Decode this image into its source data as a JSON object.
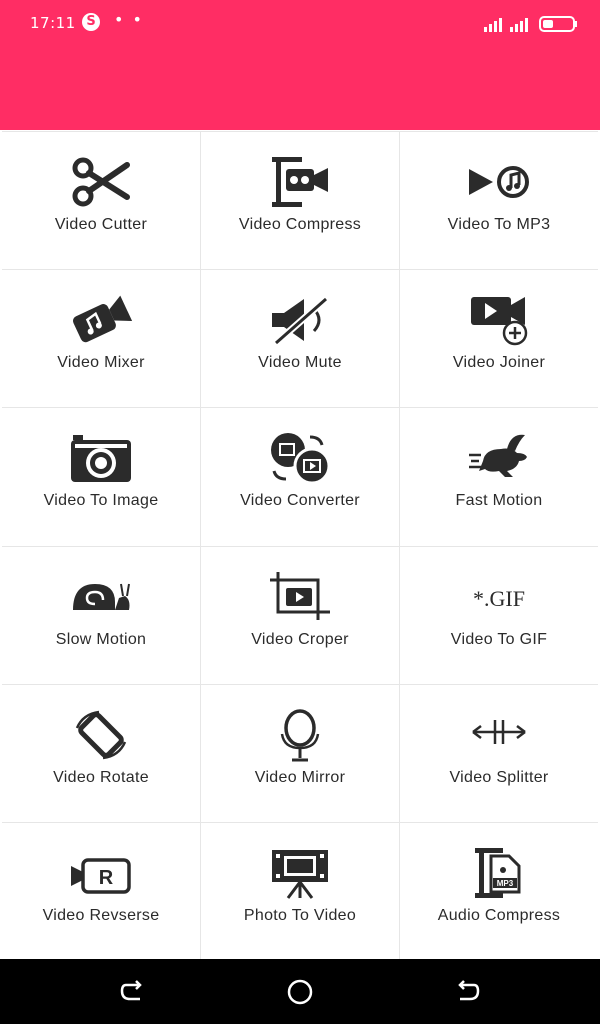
{
  "status": {
    "time": "17:11",
    "s_badge": "S",
    "dots": "• •"
  },
  "tools": [
    {
      "label": "Video Cutter",
      "icon": "scissors-icon"
    },
    {
      "label": "Video Compress",
      "icon": "compress-video-icon"
    },
    {
      "label": "Video To MP3",
      "icon": "video-to-mp3-icon"
    },
    {
      "label": "Video Mixer",
      "icon": "camera-music-icon"
    },
    {
      "label": "Video Mute",
      "icon": "mute-speaker-icon"
    },
    {
      "label": "Video Joiner",
      "icon": "video-add-icon"
    },
    {
      "label": "Video To Image",
      "icon": "camera-icon"
    },
    {
      "label": "Video Converter",
      "icon": "convert-video-icon"
    },
    {
      "label": "Fast Motion",
      "icon": "rabbit-icon"
    },
    {
      "label": "Slow Motion",
      "icon": "snail-icon"
    },
    {
      "label": "Video Croper",
      "icon": "crop-video-icon"
    },
    {
      "label": "Video To GIF",
      "icon": "gif-icon",
      "icon_text": "*.GIF"
    },
    {
      "label": "Video Rotate",
      "icon": "rotate-icon"
    },
    {
      "label": "Video Mirror",
      "icon": "mirror-icon"
    },
    {
      "label": "Video Splitter",
      "icon": "split-arrows-icon"
    },
    {
      "label": "Video Revserse",
      "icon": "reverse-camera-icon",
      "icon_text": "R"
    },
    {
      "label": "Photo To Video",
      "icon": "film-tripod-icon"
    },
    {
      "label": "Audio Compress",
      "icon": "compress-audio-icon",
      "icon_text": "MP3"
    }
  ],
  "colors": {
    "accent": "#ff2d64",
    "icon": "#2b2b2b",
    "divider": "#e6e6e6",
    "navbar": "#000000"
  }
}
